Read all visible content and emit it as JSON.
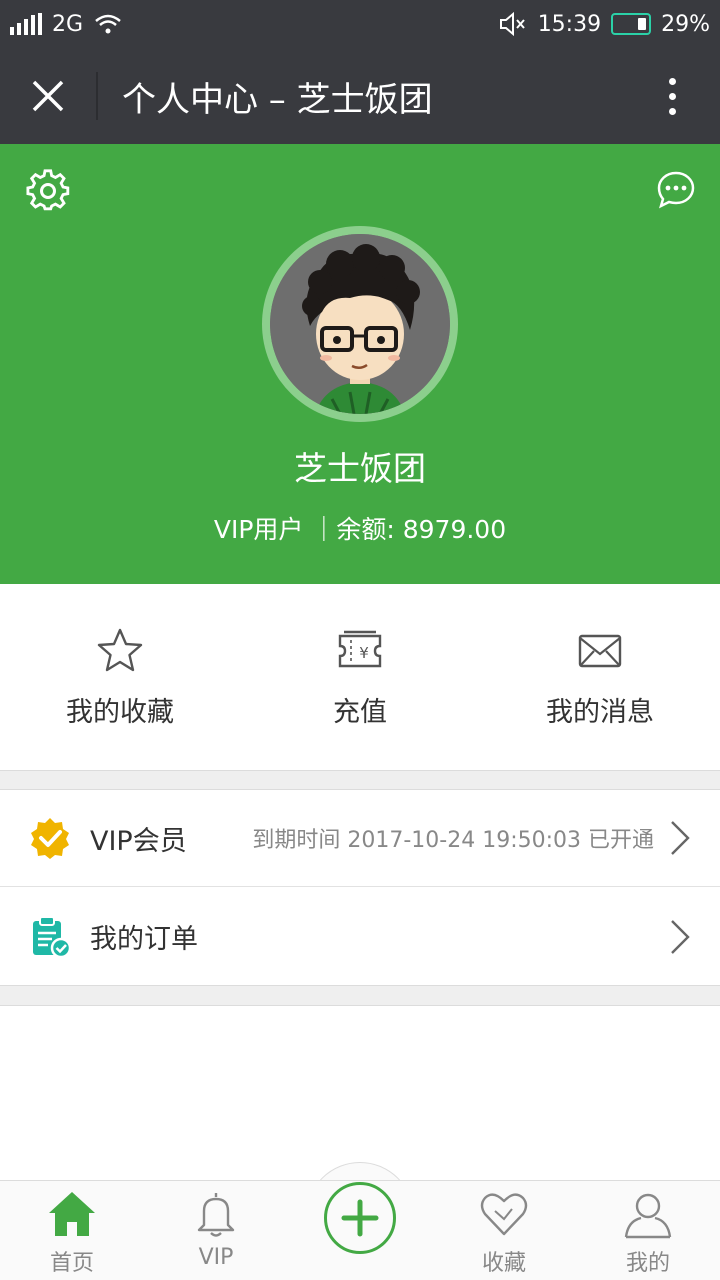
{
  "status_bar": {
    "network": "2G",
    "time": "15:39",
    "battery": "29%",
    "battery_level": 0.29,
    "signal_icon": "signal-icon",
    "wifi_icon": "wifi-icon",
    "mute_icon": "mute-icon"
  },
  "title_bar": {
    "title": "个人中心 – 芝士饭团",
    "close_icon": "close-icon",
    "more_icon": "more-vertical-icon"
  },
  "profile": {
    "name": "芝士饭团",
    "meta": "VIP用户 ｜余额: 8979.00",
    "bg_color": "#43a944"
  },
  "quick_actions": [
    {
      "label": "我的收藏",
      "icon": "star-icon"
    },
    {
      "label": "充值",
      "icon": "ticket-yen-icon"
    },
    {
      "label": "我的消息",
      "icon": "envelope-icon"
    }
  ],
  "rows": {
    "vip": {
      "label": "VIP会员",
      "detail": "到期时间 2017-10-24 19:50:03 已开通",
      "icon": "vip-badge-icon"
    },
    "orders": {
      "label": "我的订单",
      "icon": "clipboard-check-icon"
    }
  },
  "bottom_nav": [
    {
      "label": "首页",
      "icon": "home-icon",
      "active": true
    },
    {
      "label": "VIP",
      "icon": "bell-icon",
      "active": false
    },
    {
      "label": "",
      "icon": "plus-icon",
      "active": false
    },
    {
      "label": "收藏",
      "icon": "heart-icon",
      "active": false
    },
    {
      "label": "我的",
      "icon": "user-icon",
      "active": false
    }
  ],
  "colors": {
    "accent": "#43a944",
    "bar_dark": "#393a3f",
    "vip_gold": "#f0b400",
    "order_teal": "#1fb8a6"
  }
}
